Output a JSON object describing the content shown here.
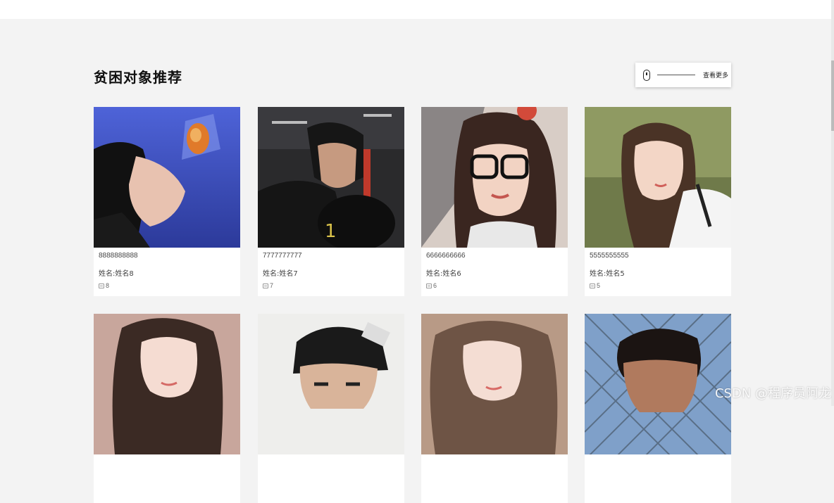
{
  "section": {
    "title": "贫困对象推荐"
  },
  "more": {
    "label": "查看更多",
    "icon": "mouse-icon"
  },
  "cards": [
    {
      "phone": "8888888888",
      "name": "姓名:姓名8",
      "count": "8",
      "bg": "#3e4fb8"
    },
    {
      "phone": "7777777777",
      "name": "姓名:姓名7",
      "count": "7",
      "bg": "#2a2a2a"
    },
    {
      "phone": "6666666666",
      "name": "姓名:姓名6",
      "count": "6",
      "bg": "#b98e7a"
    },
    {
      "phone": "5555555555",
      "name": "姓名:姓名5",
      "count": "5",
      "bg": "#7e8a55"
    },
    {
      "bg": "#c8a69c"
    },
    {
      "bg": "#e9e9e7"
    },
    {
      "bg": "#a28672"
    },
    {
      "bg": "#6a8fbf"
    }
  ],
  "watermark": "CSDN @程序员阿龙",
  "colors": {
    "page_bg": "#f3f3f3",
    "card_bg": "#ffffff",
    "title": "#111111"
  }
}
